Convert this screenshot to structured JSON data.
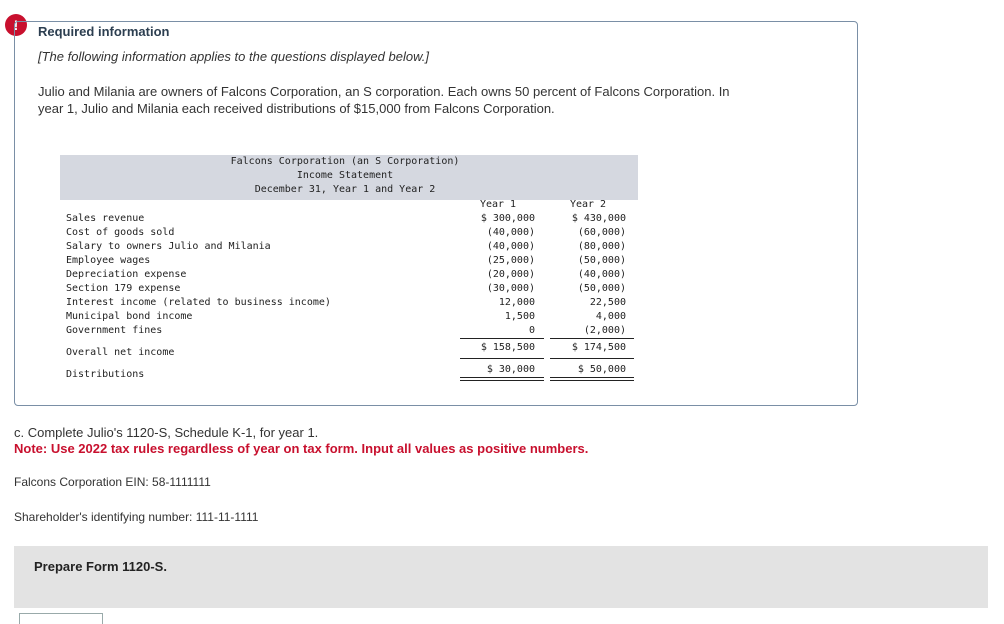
{
  "alert_icon_glyph": "!",
  "required": {
    "title": "Required information",
    "subtitle": "[The following information applies to the questions displayed below.]",
    "paragraph_line1": "Julio and Milania are owners of Falcons Corporation, an S corporation. Each owns 50 percent of Falcons Corporation. In",
    "paragraph_line2": "year 1, Julio and Milania each received distributions of $15,000 from Falcons Corporation."
  },
  "statement": {
    "title_lines": [
      "Falcons Corporation (an S Corporation)",
      "Income Statement",
      "December 31, Year 1 and Year 2"
    ],
    "columns": [
      "Year 1",
      "Year 2"
    ],
    "rows": [
      {
        "label": "Sales revenue",
        "y1": "$ 300,000",
        "y2": "$ 430,000"
      },
      {
        "label": "Cost of goods sold",
        "y1": "(40,000)",
        "y2": "(60,000)"
      },
      {
        "label": "Salary to owners Julio and Milania",
        "y1": "(40,000)",
        "y2": "(80,000)"
      },
      {
        "label": "Employee wages",
        "y1": "(25,000)",
        "y2": "(50,000)"
      },
      {
        "label": "Depreciation expense",
        "y1": "(20,000)",
        "y2": "(40,000)"
      },
      {
        "label": "Section 179 expense",
        "y1": "(30,000)",
        "y2": "(50,000)"
      },
      {
        "label": "Interest income (related to business income)",
        "y1": "12,000",
        "y2": "22,500"
      },
      {
        "label": "Municipal bond income",
        "y1": "1,500",
        "y2": "4,000"
      },
      {
        "label": "Government fines",
        "y1": "0",
        "y2": "(2,000)"
      }
    ],
    "net_income": {
      "label": "Overall net income",
      "y1": "$ 158,500",
      "y2": "$ 174,500"
    },
    "distributions": {
      "label": "Distributions",
      "y1": "$ 30,000",
      "y2": "$ 50,000"
    }
  },
  "question": {
    "text": "c. Complete Julio's 1120-S, Schedule K-1, for year 1.",
    "note": "Note: Use 2022 tax rules regardless of year on tax form. Input all values as positive numbers."
  },
  "ein": "Falcons Corporation EIN: 58-1111111",
  "shareholder_id": "Shareholder's identifying number: 111-11-1111",
  "prepare_label": "Prepare Form 1120-S."
}
